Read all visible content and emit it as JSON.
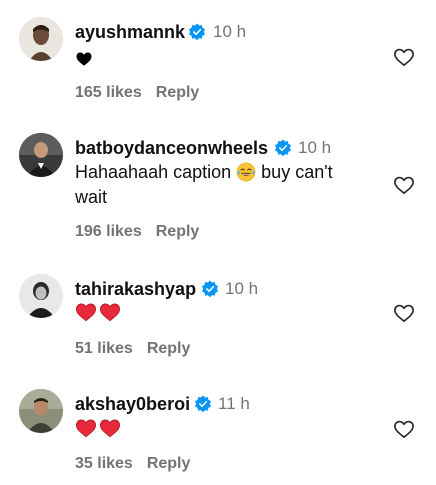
{
  "colors": {
    "verified": "#0095f6",
    "muted": "#737373",
    "heart_red": "#e6283b",
    "text": "#111111"
  },
  "comments": [
    {
      "username": "ayushmannk",
      "time": "10 h",
      "text": "",
      "reaction": "black-heart",
      "likes": "165 likes",
      "reply": "Reply"
    },
    {
      "username": "batboydanceonwheels",
      "time": "10 h",
      "text_before": "Hahaahaah caption",
      "emoji": "tears-of-joy",
      "text_after": "buy can't",
      "text_line2": "wait",
      "likes": "196 likes",
      "reply": "Reply"
    },
    {
      "username": "tahirakashyap",
      "time": "10 h",
      "reaction": "two-red-hearts",
      "likes": "51 likes",
      "reply": "Reply"
    },
    {
      "username": "akshay0beroi",
      "time": "11 h",
      "reaction": "two-red-hearts",
      "likes": "35 likes",
      "reply": "Reply"
    }
  ]
}
